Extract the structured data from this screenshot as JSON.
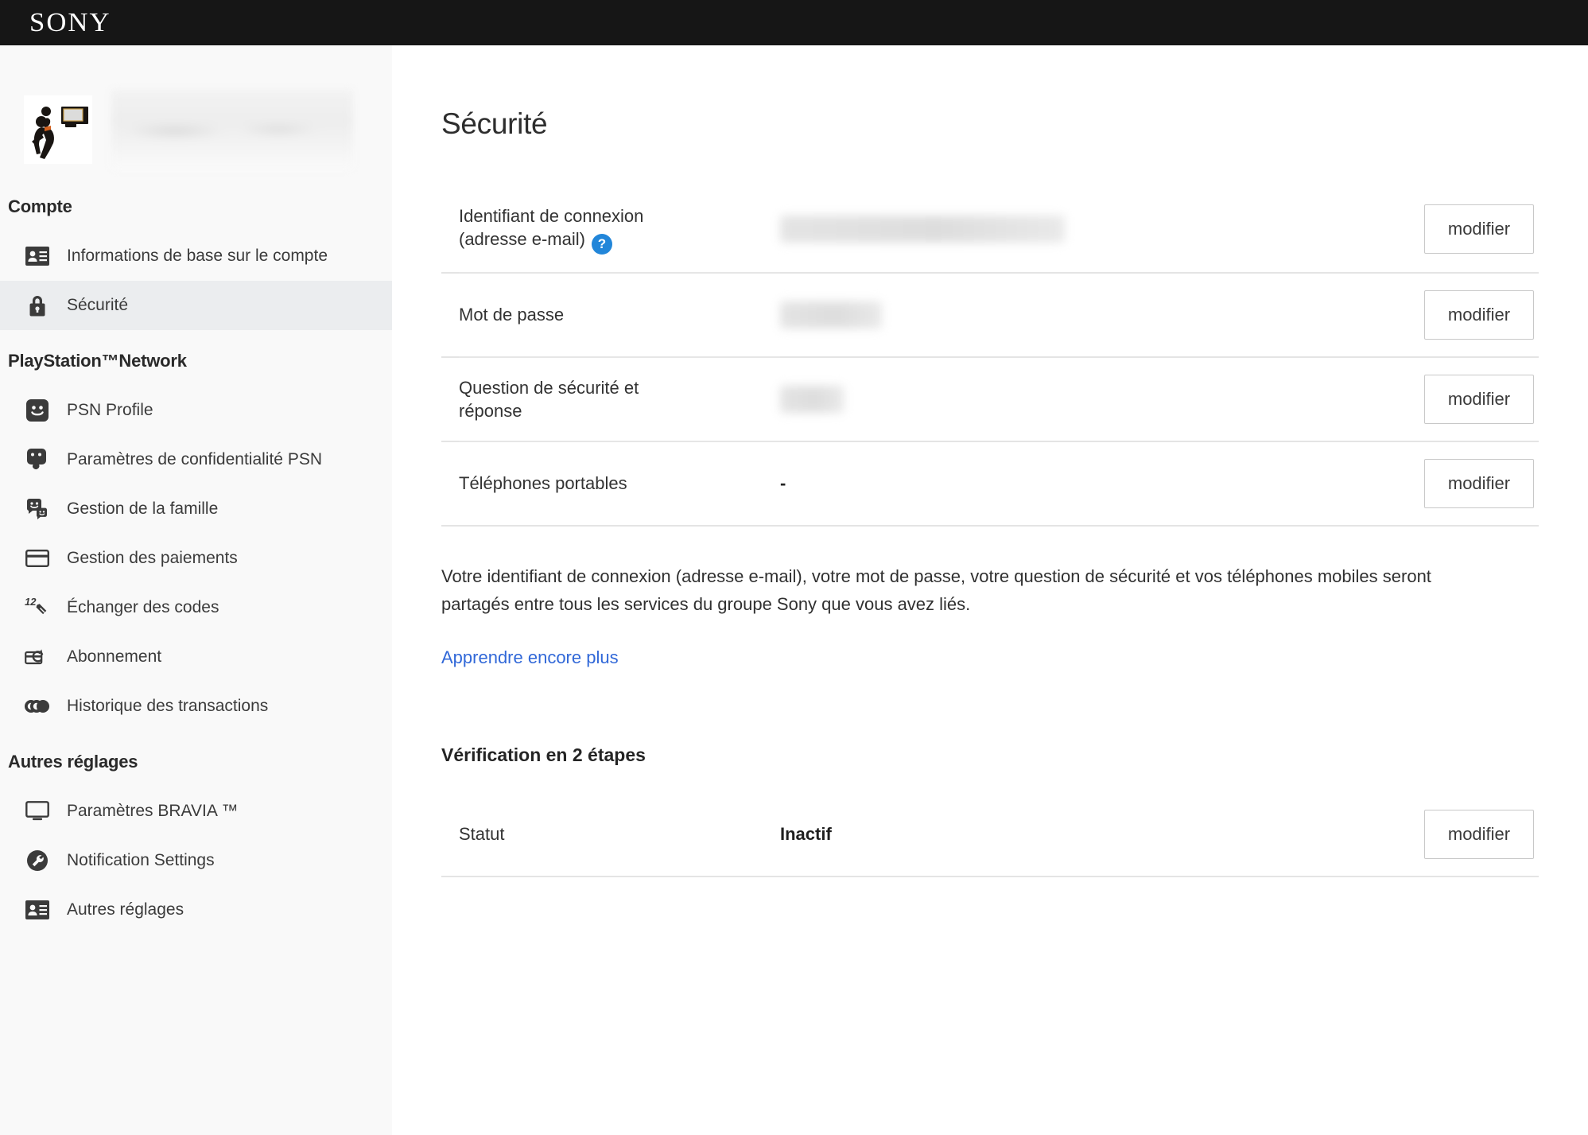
{
  "brand": {
    "logo_text": "SONY"
  },
  "profile": {
    "avatar_icon": "basketball-dunk-avatar",
    "name_redacted": true
  },
  "sidebar": {
    "sections": [
      {
        "heading": "Compte",
        "items": [
          {
            "label": "Informations de base sur le compte",
            "icon": "id-card-icon",
            "active": false
          },
          {
            "label": "Sécurité",
            "icon": "lock-icon",
            "active": true
          }
        ]
      },
      {
        "heading": "PlayStation™Network",
        "items": [
          {
            "label": "PSN Profile",
            "icon": "smiley-face-icon",
            "active": false
          },
          {
            "label": "Paramètres de confidentialité PSN",
            "icon": "privacy-mask-icon",
            "active": false
          },
          {
            "label": "Gestion de la famille",
            "icon": "family-icon",
            "active": false
          },
          {
            "label": "Gestion des paiements",
            "icon": "credit-card-icon",
            "active": false
          },
          {
            "label": "Échanger des codes",
            "icon": "redeem-code-icon",
            "active": false
          },
          {
            "label": "Abonnement",
            "icon": "subscription-renew-icon",
            "active": false
          },
          {
            "label": "Historique des transactions",
            "icon": "coins-icon",
            "active": false
          }
        ]
      },
      {
        "heading": "Autres réglages",
        "items": [
          {
            "label": "Paramètres BRAVIA ™",
            "icon": "monitor-icon",
            "active": false
          },
          {
            "label": "Notification Settings",
            "icon": "wrench-circle-icon",
            "active": false
          },
          {
            "label": "Autres réglages",
            "icon": "id-card-icon",
            "active": false
          }
        ]
      }
    ]
  },
  "main": {
    "title": "Sécurité",
    "rows": [
      {
        "label_line1": "Identifiant de connexion",
        "label_line2": "(adresse e-mail)",
        "has_help": true,
        "help_glyph": "?",
        "value": "",
        "value_redacted": true,
        "action_label": "modifier"
      },
      {
        "label_line1": "Mot de passe",
        "label_line2": "",
        "has_help": false,
        "value": "",
        "value_redacted": true,
        "action_label": "modifier"
      },
      {
        "label_line1": "Question de sécurité et",
        "label_line2": "réponse",
        "has_help": false,
        "value": "",
        "value_redacted": true,
        "action_label": "modifier"
      },
      {
        "label_line1": "Téléphones portables",
        "label_line2": "",
        "has_help": false,
        "value": "-",
        "value_redacted": false,
        "action_label": "modifier"
      }
    ],
    "note": "Votre identifiant de connexion (adresse e-mail), votre mot de passe, votre question de sécurité et vos téléphones mobiles seront partagés entre tous les services du groupe Sony que vous avez liés.",
    "learn_more_label": "Apprendre encore plus",
    "two_step": {
      "title": "Vérification en 2 étapes",
      "status_label": "Statut",
      "status_value": "Inactif",
      "action_label": "modifier"
    }
  },
  "colors": {
    "topbar_bg": "#161616",
    "sidebar_bg": "#f9f9f9",
    "active_item_bg": "#ebedef",
    "link_blue": "#3168d8",
    "help_badge_blue": "#2286d9",
    "divider": "#e4e4e4"
  }
}
